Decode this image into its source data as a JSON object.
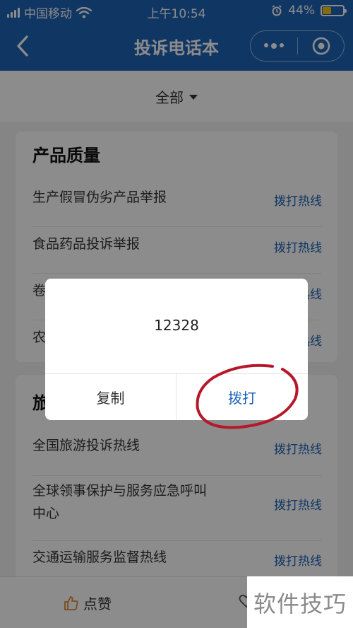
{
  "status_bar": {
    "carrier": "中国移动",
    "time": "上午10:54",
    "battery_percent": "44%",
    "battery_level": 0.44
  },
  "nav": {
    "title": "投诉电话本",
    "back_icon": "chevron-left-icon",
    "more_icon": "more-dots-icon",
    "close_icon": "target-circle-icon"
  },
  "filter": {
    "selected": "全部"
  },
  "sections": [
    {
      "title": "产品质量",
      "items": [
        {
          "label": "生产假冒伪劣产品举报",
          "action": "拨打热线"
        },
        {
          "label": "食品药品投诉举报",
          "action": "拨打热线"
        },
        {
          "label": "卷",
          "action": "拨打热线"
        },
        {
          "label": "农",
          "action": "拨打热线"
        }
      ]
    },
    {
      "title": "旅",
      "items": [
        {
          "label": "全国旅游投诉热线",
          "action": "拨打热线"
        },
        {
          "label": "全球领事保护与服务应急呼叫中心",
          "action": "拨打热线"
        },
        {
          "label": "交通运输服务监督热线",
          "action": "拨打热线"
        }
      ]
    }
  ],
  "bottom_bar": {
    "like_label": "点赞"
  },
  "dialog": {
    "number": "12328",
    "copy_label": "复制",
    "call_label": "拨打"
  },
  "watermark": "软件技巧",
  "colors": {
    "brand_blue": "#1e63b6",
    "annotation_red": "#b5182a",
    "battery_yellow": "#f5c518"
  }
}
